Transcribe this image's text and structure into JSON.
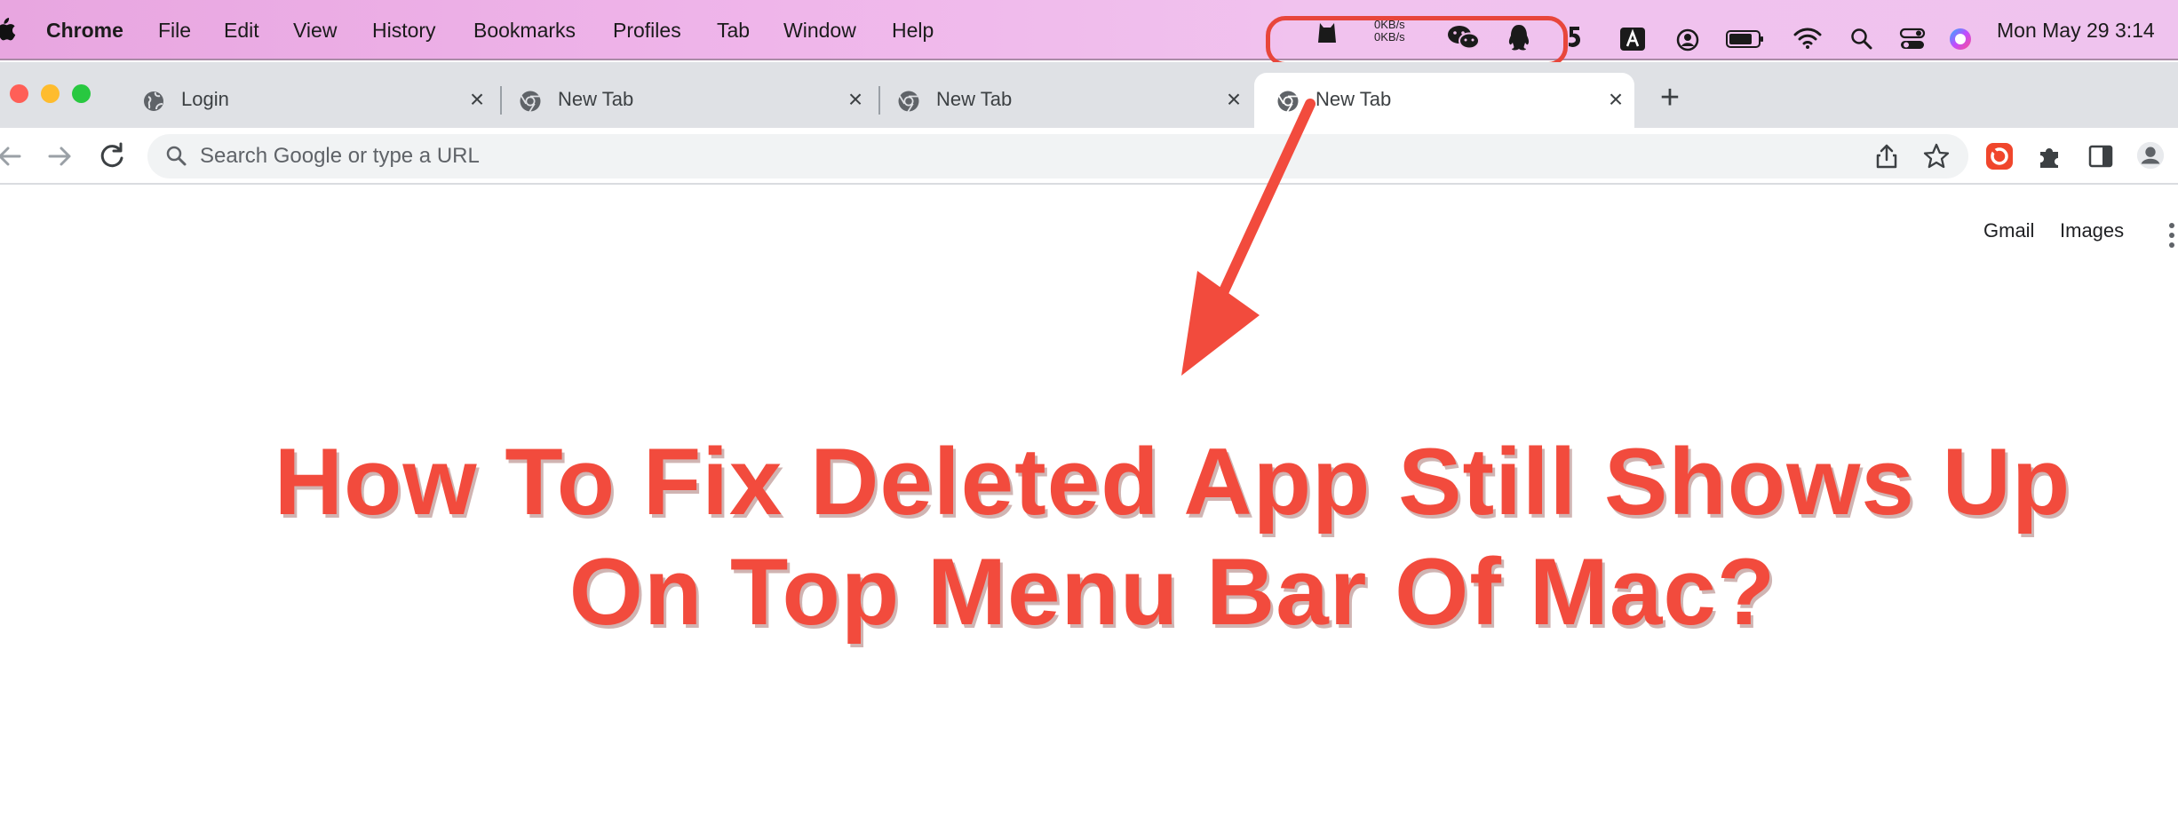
{
  "menubar": {
    "app_name": "Chrome",
    "items": [
      "File",
      "Edit",
      "View",
      "History",
      "Bookmarks",
      "Profiles",
      "Tab",
      "Window",
      "Help"
    ],
    "net_up": "0KB/s",
    "net_down": "0KB/s",
    "clock": "Mon May 29  3:14",
    "status_icons": [
      "cat-icon",
      "wechat-icon",
      "qq-penguin-icon",
      "five-icon",
      "input-a-icon",
      "user-circle-icon",
      "battery-icon",
      "wifi-icon",
      "search-icon",
      "control-center-icon",
      "siri-icon"
    ]
  },
  "tabs": [
    {
      "title": "Login",
      "active": false
    },
    {
      "title": "New Tab",
      "active": false
    },
    {
      "title": "New Tab",
      "active": false
    },
    {
      "title": "New Tab",
      "active": true
    }
  ],
  "toolbar": {
    "omnibox_placeholder": "Search Google or type a URL"
  },
  "page": {
    "gmail": "Gmail",
    "images": "Images"
  },
  "overlay": {
    "headline_line1": "How To Fix Deleted App Still Shows Up",
    "headline_line2": "On Top Menu Bar Of Mac?",
    "accent_color": "#f24b3d"
  },
  "colors": {
    "menubar_tint": "#efb5ea",
    "tabstrip": "#dfe1e5",
    "close_red": "#ff5f57",
    "minimize_yellow": "#febc2e",
    "zoom_green": "#28c840"
  }
}
